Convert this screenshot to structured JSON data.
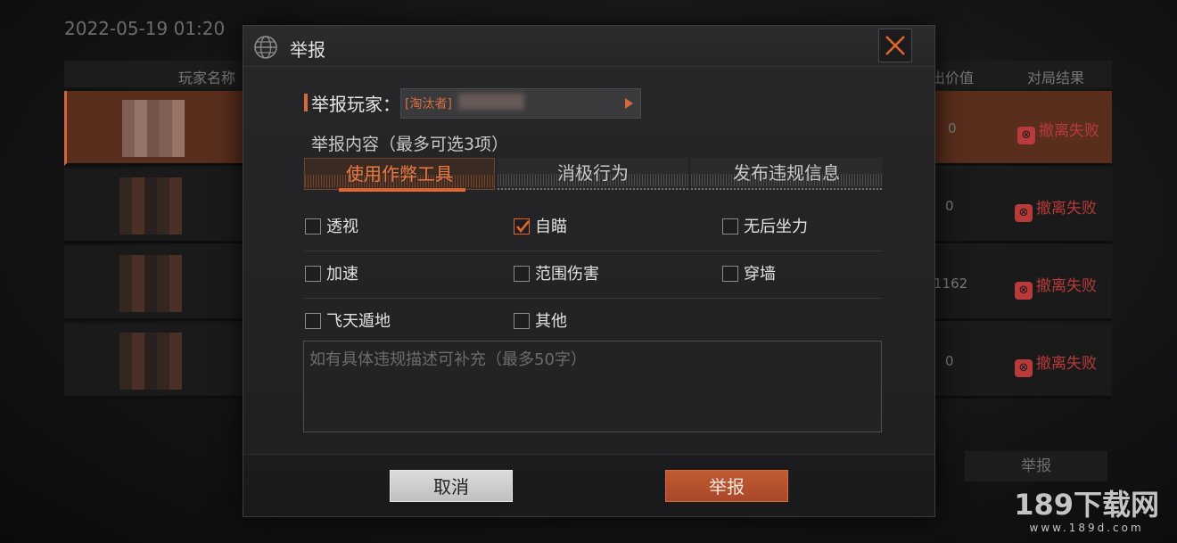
{
  "background": {
    "date": "2022-05-19 01:20",
    "columns": {
      "player_name": "玩家名称",
      "value": "出价值",
      "result": "对局结果"
    },
    "rows": [
      {
        "value": "0",
        "result": "撤离失败",
        "highlighted": true
      },
      {
        "value": "0",
        "result": "撤离失败",
        "highlighted": false
      },
      {
        "value": "1162",
        "result": "撤离失败",
        "highlighted": false
      },
      {
        "value": "0",
        "result": "撤离失败",
        "highlighted": false
      }
    ],
    "report_button": "举报",
    "watermark": "189下载网",
    "watermark_url": "www.189d.com"
  },
  "modal": {
    "title": "举报",
    "reporter_label": "举报玩家：",
    "reporter_value": "[淘汰者]",
    "content_hint": "举报内容（最多可选3项）",
    "tabs": [
      {
        "label": "使用作弊工具",
        "active": true
      },
      {
        "label": "消极行为",
        "active": false
      },
      {
        "label": "发布违规信息",
        "active": false
      }
    ],
    "options": [
      {
        "label": "透视",
        "checked": false
      },
      {
        "label": "自瞄",
        "checked": true
      },
      {
        "label": "无后坐力",
        "checked": false
      },
      {
        "label": "加速",
        "checked": false
      },
      {
        "label": "范围伤害",
        "checked": false
      },
      {
        "label": "穿墙",
        "checked": false
      },
      {
        "label": "飞天遁地",
        "checked": false
      },
      {
        "label": "其他",
        "checked": false
      }
    ],
    "description_placeholder": "如有具体违规描述可补充（最多50字）",
    "cancel_label": "取消",
    "submit_label": "举报"
  },
  "colors": {
    "accent": "#e0652f",
    "fail": "#b83a3a"
  }
}
